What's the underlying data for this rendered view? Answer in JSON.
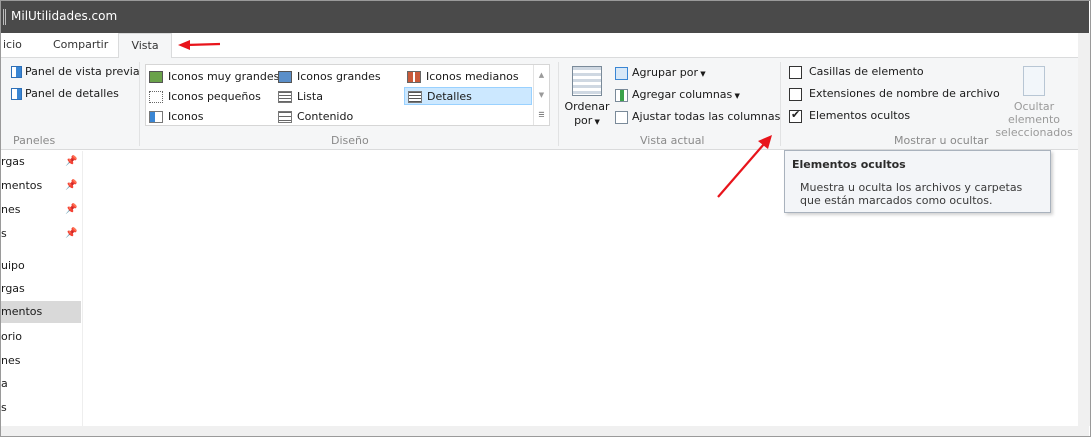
{
  "window": {
    "title": "MilUtilidades.com"
  },
  "tabs": [
    {
      "label": "icio"
    },
    {
      "label": "Compartir"
    },
    {
      "label": "Vista"
    }
  ],
  "ribbon": {
    "paneles": {
      "label": "Paneles",
      "items": [
        "Panel de vista previa",
        "Panel de detalles"
      ]
    },
    "diseno": {
      "label": "Diseño",
      "items": [
        "Iconos muy grandes",
        "Iconos grandes",
        "Iconos medianos",
        "Iconos pequeños",
        "Lista",
        "Detalles",
        "Iconos",
        "Contenido"
      ],
      "selected": "Detalles"
    },
    "vista_actual": {
      "label": "Vista actual",
      "ordenar": {
        "line1": "Ordenar",
        "line2": "por"
      },
      "agrupar": "Agrupar por",
      "agregar_columnas": "Agregar columnas",
      "ajustar": "Ajustar todas las columnas"
    },
    "mostrar": {
      "label": "Mostrar u ocultar",
      "checkboxes": [
        {
          "label": "Casillas de elemento",
          "checked": false
        },
        {
          "label": "Extensiones de nombre de archivo",
          "checked": false
        },
        {
          "label": "Elementos ocultos",
          "checked": true
        }
      ],
      "ocultar": {
        "line1": "Ocultar elemento",
        "line2": "seleccionados"
      }
    }
  },
  "nav": {
    "items": [
      {
        "label": "rgas",
        "pinned": true
      },
      {
        "label": "mentos",
        "pinned": true
      },
      {
        "label": "nes",
        "pinned": true
      },
      {
        "label": "s",
        "pinned": true
      },
      {
        "label": "uipo",
        "pinned": false
      },
      {
        "label": "rgas",
        "pinned": false
      },
      {
        "label": "mentos",
        "pinned": false,
        "selected": true
      },
      {
        "label": "orio",
        "pinned": false
      },
      {
        "label": "nes",
        "pinned": false
      },
      {
        "label": "a",
        "pinned": false
      },
      {
        "label": "s",
        "pinned": false
      }
    ]
  },
  "tooltip": {
    "title": "Elementos ocultos",
    "body": "Muestra u oculta los archivos y carpetas que están marcados como ocultos."
  },
  "colors": {
    "titlebar": "#4a4a4a",
    "ribbon": "#f5f6f7",
    "selection": "#cce8ff",
    "annotation_arrow": "#e8141b"
  }
}
